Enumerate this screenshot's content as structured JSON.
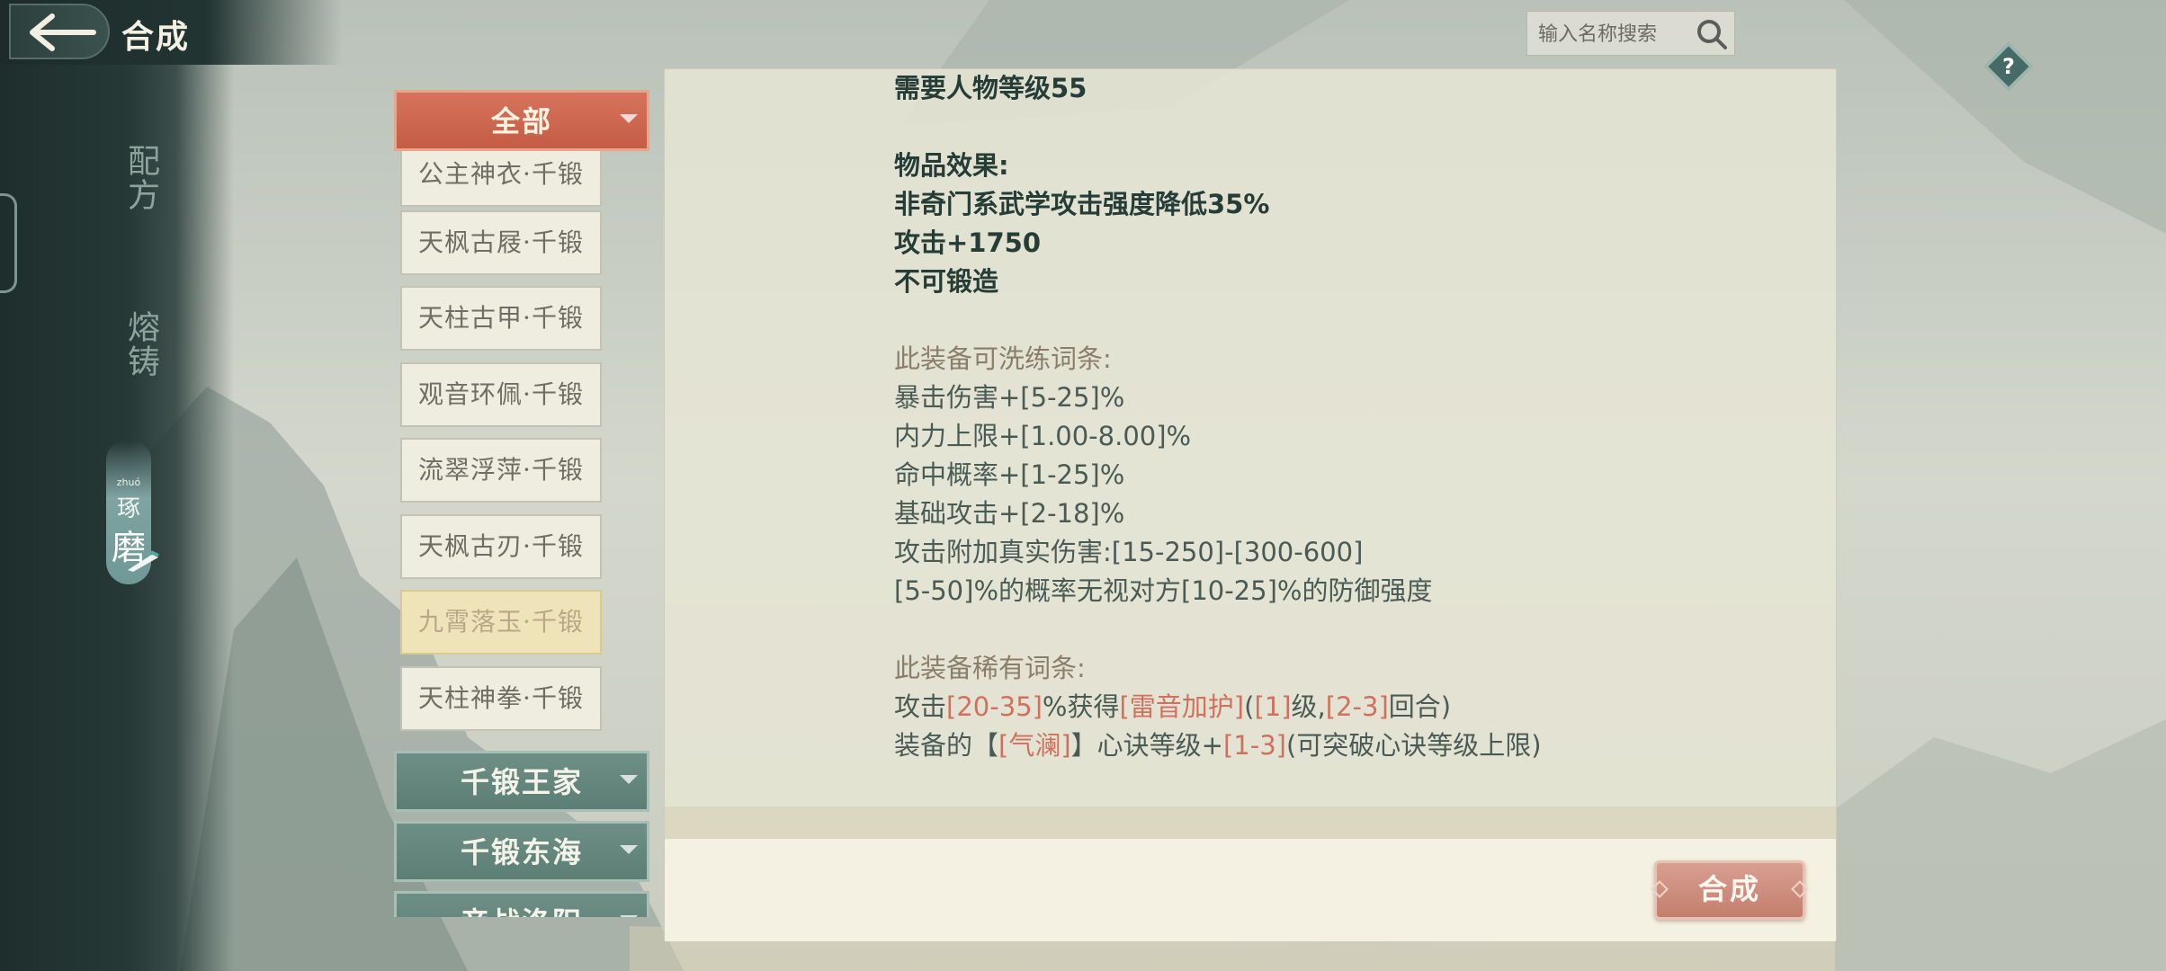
{
  "header": {
    "title": "合成",
    "back_icon": "back-arrow-icon"
  },
  "search": {
    "placeholder": "输入名称搜索",
    "icon": "search-icon"
  },
  "help": {
    "label": "?"
  },
  "nav": {
    "tabs": [
      {
        "label": "配方",
        "active": false
      },
      {
        "label": "熔铸",
        "active": false
      },
      {
        "label": "琢磨",
        "active": true,
        "ruby": "zhuó",
        "char1": "琢",
        "char2": "磨"
      }
    ]
  },
  "recipes": {
    "active_category": "全部",
    "items": [
      "公主神衣·千锻",
      "天枫古屐·千锻",
      "天柱古甲·千锻",
      "观音环佩·千锻",
      "流翠浮萍·千锻",
      "天枫古刃·千锻",
      "九霄落玉·千锻",
      "天柱神拳·千锻"
    ],
    "selected_index": 6,
    "categories": [
      "千锻王家",
      "千锻东海",
      "帝战洛阳"
    ]
  },
  "detail": {
    "level_req": "需要人物等级55",
    "effect_title": "物品效果:",
    "effects": [
      "非奇门系武学攻击强度降低35%",
      "攻击+1750",
      "不可锻造"
    ],
    "refine_title": "此装备可洗练词条:",
    "refine_lines": [
      "暴击伤害+[5-25]%",
      "内力上限+[1.00-8.00]%",
      "命中概率+[1-25]%",
      "基础攻击+[2-18]%",
      "攻击附加真实伤害:[15-250]-[300-600]",
      "[5-50]%的概率无视对方[10-25]%的防御强度"
    ],
    "rare_title": "此装备稀有词条:",
    "rare1": {
      "p1": "攻击",
      "v1": "[20-35]",
      "p2": "%获得",
      "v2": "[雷音加护]",
      "p3": "(",
      "v3": "[1]",
      "p4": "级,",
      "v4": "[2-3]",
      "p5": "回合)"
    },
    "rare2": {
      "p1": "装备的【",
      "v1": "[气澜]",
      "p2": "】心诀等级+",
      "v2": "[1-3]",
      "p3": "(可突破心诀等级上限)"
    }
  },
  "action": {
    "synthesize_label": "合成"
  },
  "colors": {
    "accent_red": "#c55c45",
    "highlight": "#d0715e",
    "teal": "#5c7e75",
    "selected_item": "#efe3b9"
  }
}
